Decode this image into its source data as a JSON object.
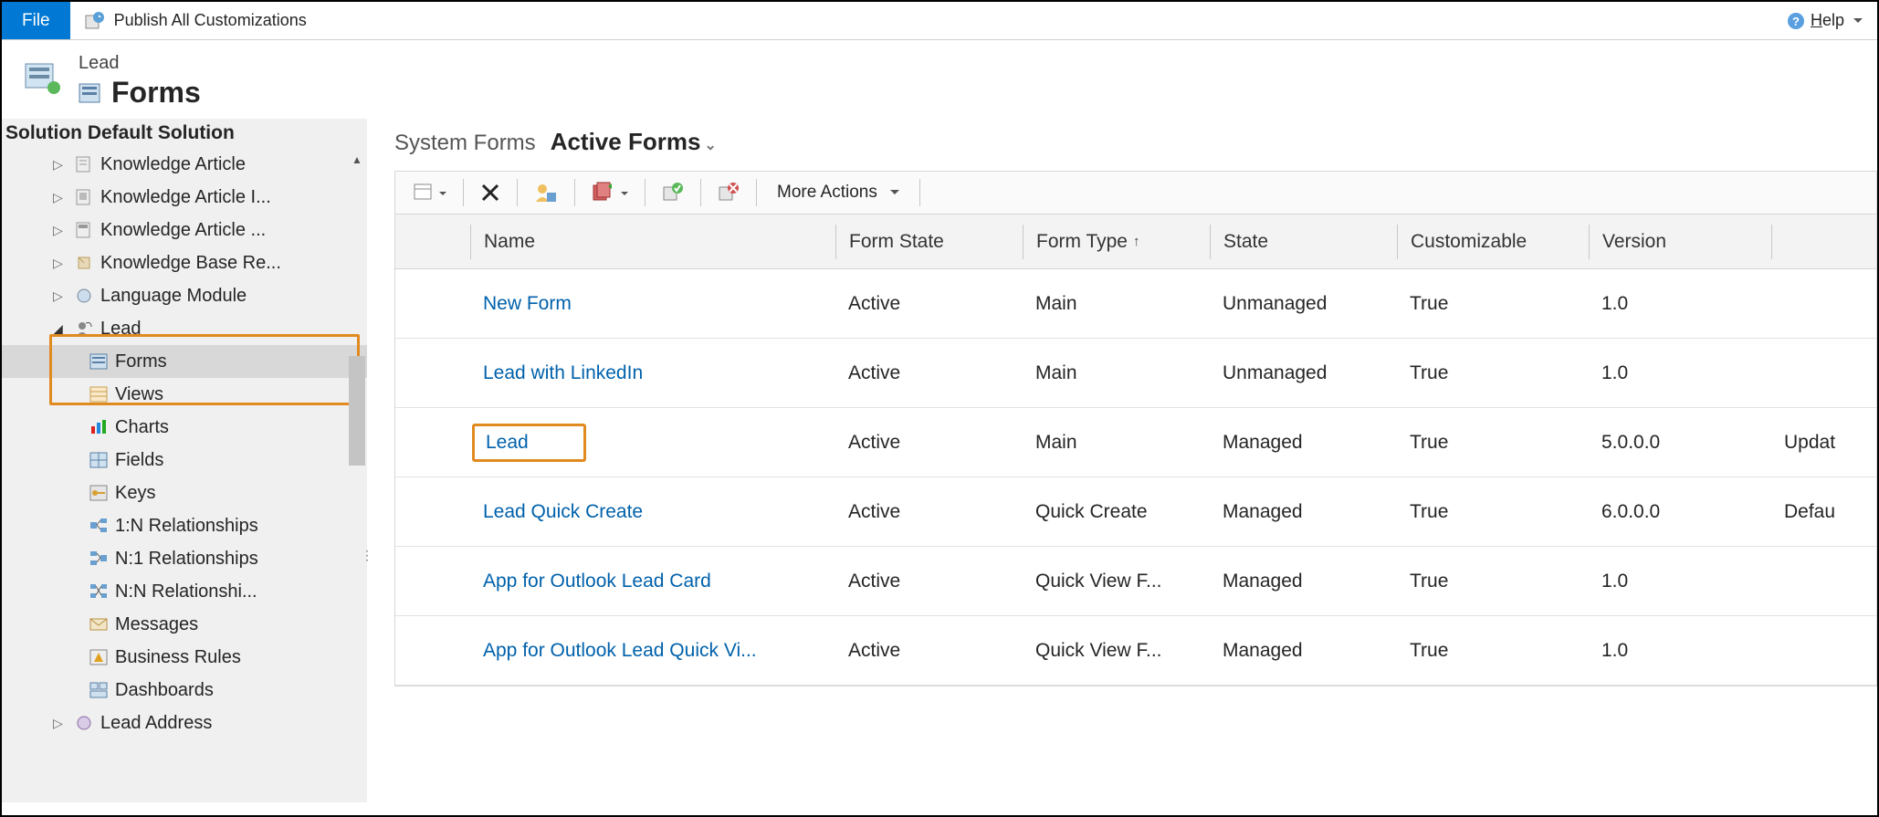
{
  "ribbon": {
    "file_label": "File",
    "publish_label": "Publish All Customizations",
    "help_label": "Help"
  },
  "header": {
    "entity_name": "Lead",
    "page_title": "Forms"
  },
  "sidebar": {
    "solution_label": "Solution Default Solution",
    "items": [
      {
        "label": "Knowledge Article",
        "expandable": true
      },
      {
        "label": "Knowledge Article I...",
        "expandable": true
      },
      {
        "label": "Knowledge Article ...",
        "expandable": true
      },
      {
        "label": "Knowledge Base Re...",
        "expandable": true
      },
      {
        "label": "Language Module",
        "expandable": true
      },
      {
        "label": "Lead",
        "expandable": true,
        "expanded": true
      },
      {
        "label": "Lead Address",
        "expandable": true
      }
    ],
    "lead_children": [
      {
        "label": "Forms",
        "selected": true
      },
      {
        "label": "Views"
      },
      {
        "label": "Charts"
      },
      {
        "label": "Fields"
      },
      {
        "label": "Keys"
      },
      {
        "label": "1:N Relationships"
      },
      {
        "label": "N:1 Relationships"
      },
      {
        "label": "N:N Relationshi..."
      },
      {
        "label": "Messages"
      },
      {
        "label": "Business Rules"
      },
      {
        "label": "Dashboards"
      }
    ]
  },
  "list_header": {
    "title": "System Forms",
    "view": "Active Forms"
  },
  "toolbar": {
    "more_actions": "More Actions"
  },
  "grid": {
    "columns": {
      "name": "Name",
      "form_state": "Form State",
      "form_type": "Form Type",
      "state": "State",
      "customizable": "Customizable",
      "version": "Version"
    },
    "rows": [
      {
        "name": "New Form",
        "form_state": "Active",
        "form_type": "Main",
        "state": "Unmanaged",
        "customizable": "True",
        "version": "1.0",
        "desc": ""
      },
      {
        "name": "Lead with LinkedIn",
        "form_state": "Active",
        "form_type": "Main",
        "state": "Unmanaged",
        "customizable": "True",
        "version": "1.0",
        "desc": ""
      },
      {
        "name": "Lead",
        "form_state": "Active",
        "form_type": "Main",
        "state": "Managed",
        "customizable": "True",
        "version": "5.0.0.0",
        "desc": "Updat",
        "highlight": true
      },
      {
        "name": "Lead Quick Create",
        "form_state": "Active",
        "form_type": "Quick Create",
        "state": "Managed",
        "customizable": "True",
        "version": "6.0.0.0",
        "desc": "Defau"
      },
      {
        "name": "App for Outlook Lead Card",
        "form_state": "Active",
        "form_type": "Quick View F...",
        "state": "Managed",
        "customizable": "True",
        "version": "1.0",
        "desc": ""
      },
      {
        "name": "App for Outlook Lead Quick Vi...",
        "form_state": "Active",
        "form_type": "Quick View F...",
        "state": "Managed",
        "customizable": "True",
        "version": "1.0",
        "desc": ""
      }
    ]
  }
}
